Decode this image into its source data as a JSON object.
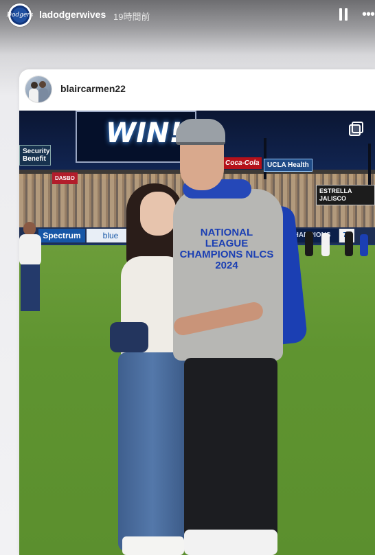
{
  "story": {
    "account_name": "ladodgerwives",
    "timestamp": "19時間前",
    "avatar_label": "Dodgers",
    "pause_icon": "pause-icon",
    "more_icon": "more-horizontal-icon"
  },
  "post": {
    "username": "blaircarmen22",
    "carousel_icon": "multiple-images-icon",
    "photo": {
      "scoreboard_text": "WIN!",
      "signs": {
        "security": "Security Benefit",
        "cola": "Coca-Cola",
        "ucla": "UCLA Health",
        "jalisco": "ESTRELLA JALISCO",
        "dasbo": "DASBO",
        "spectrum": "Spectrum",
        "blue": "blue",
        "champions": "CHAMPIONS",
        "number": "76"
      },
      "shirt_text": "NATIONAL LEAGUE CHAMPIONS NLCS 2024"
    }
  }
}
